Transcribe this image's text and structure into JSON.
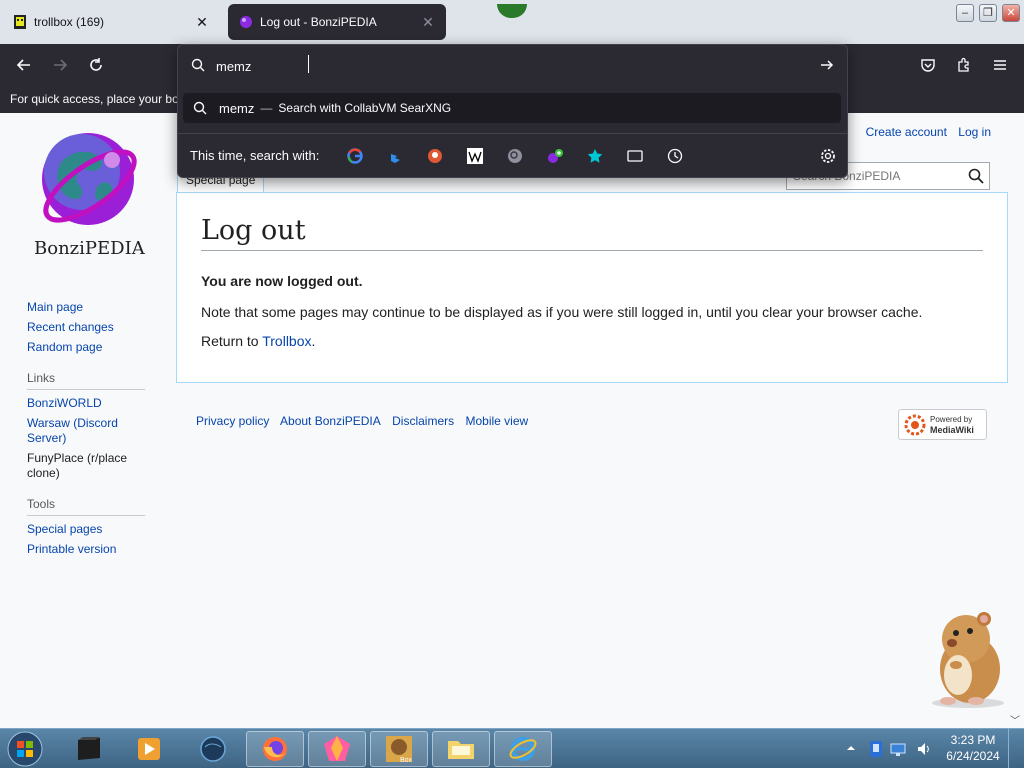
{
  "browser": {
    "tabs": [
      {
        "title": "trollbox (169)",
        "active": false
      },
      {
        "title": "Log out - BonziPEDIA",
        "active": true
      }
    ],
    "bookmarks_hint": "For quick access, place your bo",
    "urlbar": {
      "query": "memz",
      "suggestion": {
        "text": "memz",
        "separator": "—",
        "engine_text": "Search with CollabVM SearXNG"
      },
      "oneoff_label": "This time, search with:",
      "engines": [
        "google-icon",
        "bing-icon",
        "duckduckgo-icon",
        "wikipedia-icon",
        "searxng-icon",
        "custom-engine-icon",
        "bookmarks-icon",
        "tabs-icon",
        "history-icon"
      ]
    }
  },
  "wiki": {
    "site_name": "BonziPEDIA",
    "personal": {
      "create_account": "Create account",
      "login": "Log in"
    },
    "search_placeholder": "Search BonziPEDIA",
    "page_tab": "Special page",
    "heading": "Log out",
    "logged_out": "You are now logged out.",
    "note": "Note that some pages may continue to be displayed as if you were still logged in, until you clear your browser cache.",
    "return_prefix": "Return to ",
    "return_link": "Trollbox",
    "return_suffix": ".",
    "nav": [
      "Main page",
      "Recent changes",
      "Random page"
    ],
    "links_heading": "Links",
    "links": [
      "BonziWORLD",
      "Warsaw (Discord Server)",
      "FunyPlace (r/place clone)"
    ],
    "tools_heading": "Tools",
    "tools": [
      "Special pages",
      "Printable version"
    ],
    "footer": [
      "Privacy policy",
      "About BonziPEDIA",
      "Disclaimers",
      "Mobile view"
    ],
    "powered_by": {
      "line1": "Powered by",
      "line2": "MediaWiki"
    }
  },
  "taskbar": {
    "clock_time": "3:23 PM",
    "clock_date": "6/24/2024"
  },
  "colors": {
    "link": "#0645ad",
    "browser_dark": "#2b2a33",
    "taskbar": "#4a7394"
  }
}
